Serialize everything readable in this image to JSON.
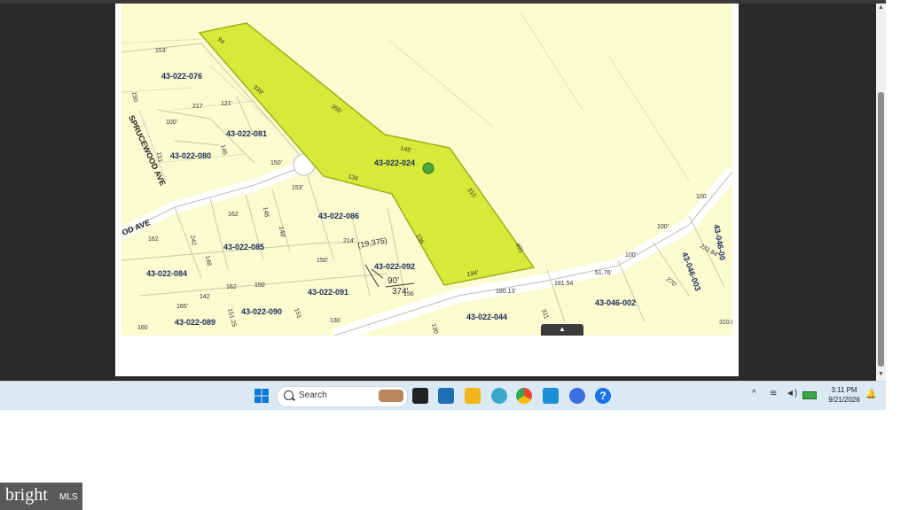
{
  "map": {
    "subject_parcel": "43-022-024",
    "parcels": [
      "43-022-076",
      "43-022-081",
      "43-022-080",
      "43-022-086",
      "43-022-085",
      "43-022-084",
      "43-022-092",
      "43-022-091",
      "43-022-090",
      "43-022-089",
      "43-022-044",
      "43-046-002",
      "43-046-003",
      "43-046-00"
    ],
    "streets": [
      "SPRUCEWOOD AVE",
      "OD AVE"
    ],
    "dimensions": [
      "94",
      "339'",
      "355'",
      "145'",
      "134",
      "310",
      "236",
      "194'",
      "491",
      "153'",
      "150",
      "217",
      "121'",
      "100'",
      "151",
      "146",
      "150'",
      "153'",
      "162",
      "148",
      "148'",
      "214'",
      "134",
      "150'",
      "162",
      "242",
      "148",
      "162",
      "150",
      "142",
      "165'",
      "151.25",
      "151",
      "160",
      "130",
      "180.13'",
      "181.54",
      "51.76'",
      "100'",
      "100'",
      "270'",
      "100",
      "231.84'",
      "310.8'",
      "311",
      "19,375",
      "90'",
      "374'",
      "156"
    ]
  },
  "taskbar": {
    "search_label": "Search",
    "time": "3:11 PM",
    "date": "9/21/2026"
  },
  "watermark": {
    "brand": "bright",
    "suffix": "MLS"
  },
  "colors": {
    "parcel_fill": "#d7ea3a",
    "map_bg": "#fbfbd0",
    "taskbar_bg": "#dbe9f4",
    "ink": "#1f2a5a"
  }
}
